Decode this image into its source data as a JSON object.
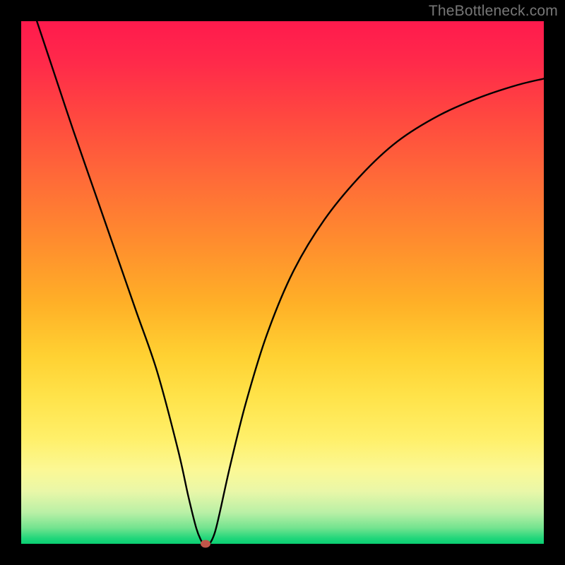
{
  "watermark": "TheBottleneck.com",
  "chart_data": {
    "type": "line",
    "title": "",
    "xlabel": "",
    "ylabel": "",
    "xlim": [
      0,
      100
    ],
    "ylim": [
      0,
      100
    ],
    "grid": false,
    "series": [
      {
        "name": "curve",
        "x": [
          3,
          6,
          10,
          14,
          18,
          22,
          26,
          30,
          32,
          33.5,
          34.5,
          35,
          36,
          37,
          38,
          40,
          43,
          47,
          52,
          58,
          65,
          72,
          80,
          88,
          95,
          100
        ],
        "y": [
          100,
          91,
          79,
          67.5,
          56,
          44.5,
          33,
          18,
          9,
          3,
          0.5,
          0,
          0,
          2,
          6,
          15,
          27,
          40,
          52,
          62,
          70.5,
          77,
          82,
          85.5,
          87.8,
          89
        ]
      }
    ],
    "marker": {
      "x": 35.3,
      "y": 0
    },
    "background_gradient": {
      "top": "#ff1a4d",
      "mid": "#ffd132",
      "bottom": "#0acf72"
    }
  }
}
